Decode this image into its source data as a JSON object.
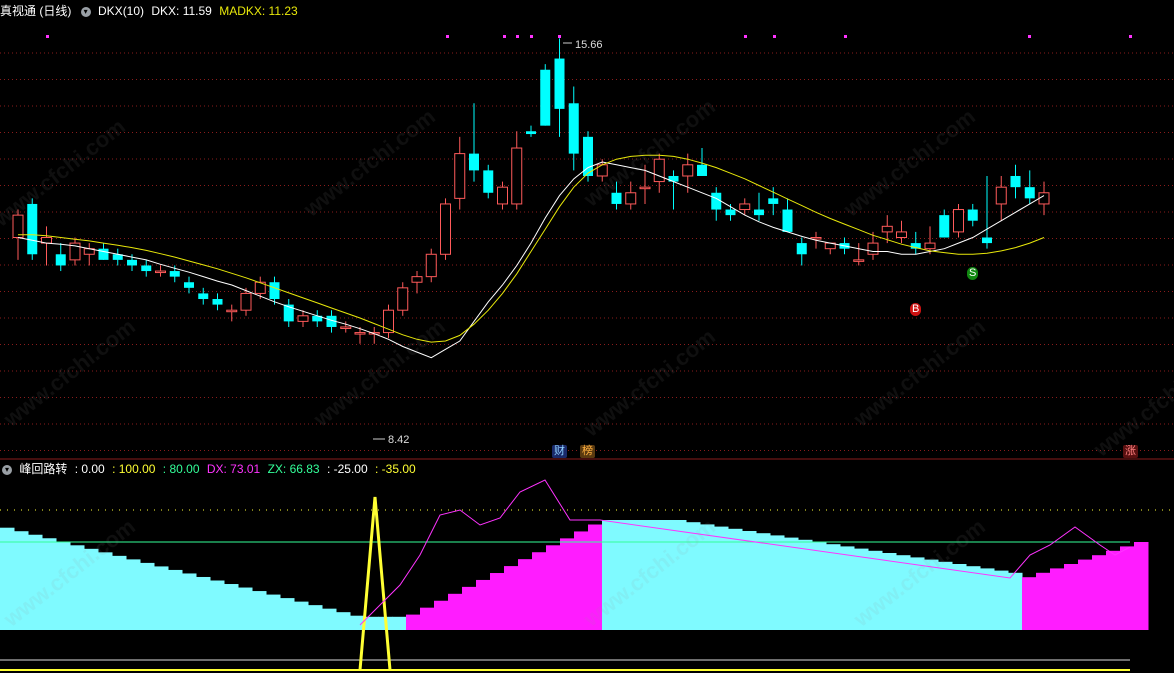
{
  "header": {
    "title": "真视通 (日线)",
    "indicator_label": "DKX(10)",
    "dkx_label": "DKX: 11.59",
    "madkx_label": "MADKX: 11.23"
  },
  "lower_header": {
    "title": "峰回路转",
    "items": [
      ": 0.00",
      ": 100.00",
      ": 80.00",
      "DX: 73.01",
      "ZX: 66.83",
      ": -25.00",
      ": -35.00"
    ]
  },
  "annotations": {
    "high_label": "15.66",
    "low_label": "8.42"
  },
  "markers": {
    "buy": "B",
    "sell": "S",
    "cai": "财",
    "bang": "榜",
    "zhang": "涨"
  },
  "watermark": "www.cfchi.com",
  "colors": {
    "up": "#ff5a5a",
    "down": "#00ffff",
    "dkx": "#ffffff",
    "madkx": "#e8e80a",
    "cyan_fill": "#7ffaff",
    "magenta_fill": "#ff1cff",
    "dx": "#ff33ff",
    "yellow": "#ffff33",
    "green": "#33ff99",
    "grid": "#8a1c1c"
  },
  "chart_data": [
    {
      "type": "candlestick",
      "title": "真视通 (日线)",
      "series": [
        {
          "name": "DKX",
          "values": [
            12.1,
            12.05,
            12.0,
            11.98,
            11.95,
            11.9,
            11.85,
            11.8,
            11.75,
            11.7,
            11.62,
            11.55,
            11.48,
            11.4,
            11.32,
            11.25,
            11.15,
            11.05,
            10.95,
            10.86,
            10.78,
            10.7,
            10.62,
            10.55,
            10.47,
            10.38,
            10.28,
            10.15,
            10.05,
            9.95,
            10.1,
            10.25,
            10.6,
            10.95,
            11.25,
            11.6,
            12.0,
            12.45,
            12.85,
            13.15,
            13.35,
            13.45,
            13.4,
            13.35,
            13.3,
            13.2,
            13.1,
            13.0,
            12.9,
            12.8,
            12.65,
            12.5,
            12.38,
            12.28,
            12.2,
            12.12,
            12.05,
            12.0,
            11.95,
            11.9,
            11.85,
            11.85,
            11.8,
            11.8,
            11.85,
            11.9,
            12.0,
            12.1,
            12.25,
            12.4,
            12.55,
            12.7,
            12.85
          ]
        },
        {
          "name": "MADKX",
          "values": [
            12.15,
            12.15,
            12.13,
            12.1,
            12.07,
            12.04,
            12.0,
            11.96,
            11.92,
            11.87,
            11.81,
            11.75,
            11.68,
            11.61,
            11.54,
            11.46,
            11.38,
            11.29,
            11.2,
            11.11,
            11.02,
            10.93,
            10.84,
            10.75,
            10.66,
            10.56,
            10.46,
            10.36,
            10.28,
            10.23,
            10.25,
            10.35,
            10.55,
            10.8,
            11.1,
            11.45,
            11.85,
            12.25,
            12.65,
            13.0,
            13.25,
            13.4,
            13.5,
            13.55,
            13.57,
            13.57,
            13.55,
            13.5,
            13.43,
            13.35,
            13.25,
            13.15,
            13.03,
            12.91,
            12.79,
            12.67,
            12.55,
            12.44,
            12.34,
            12.24,
            12.14,
            12.06,
            11.98,
            11.92,
            11.86,
            11.83,
            11.8,
            11.8,
            11.82,
            11.86,
            11.92,
            12.0,
            12.1
          ]
        }
      ],
      "ohlc": [
        [
          12.1,
          12.6,
          11.7,
          12.5
        ],
        [
          12.7,
          12.8,
          11.7,
          11.8
        ],
        [
          12.0,
          12.3,
          11.6,
          12.1
        ],
        [
          11.8,
          12.0,
          11.5,
          11.6
        ],
        [
          11.7,
          12.1,
          11.6,
          12.0
        ],
        [
          11.8,
          12.0,
          11.6,
          11.9
        ],
        [
          11.9,
          12.0,
          11.7,
          11.7
        ],
        [
          11.8,
          11.9,
          11.6,
          11.7
        ],
        [
          11.7,
          11.8,
          11.5,
          11.6
        ],
        [
          11.6,
          11.7,
          11.4,
          11.5
        ],
        [
          11.5,
          11.6,
          11.4,
          11.5
        ],
        [
          11.5,
          11.6,
          11.3,
          11.4
        ],
        [
          11.3,
          11.4,
          11.1,
          11.2
        ],
        [
          11.1,
          11.2,
          10.9,
          11.0
        ],
        [
          11.0,
          11.1,
          10.8,
          10.9
        ],
        [
          10.8,
          10.9,
          10.6,
          10.8
        ],
        [
          10.8,
          11.2,
          10.7,
          11.1
        ],
        [
          11.1,
          11.4,
          11.0,
          11.3
        ],
        [
          11.3,
          11.4,
          10.9,
          11.0
        ],
        [
          10.9,
          11.0,
          10.5,
          10.6
        ],
        [
          10.6,
          10.8,
          10.5,
          10.7
        ],
        [
          10.7,
          10.8,
          10.5,
          10.6
        ],
        [
          10.7,
          10.8,
          10.4,
          10.5
        ],
        [
          10.5,
          10.6,
          10.4,
          10.5
        ],
        [
          10.4,
          10.5,
          10.2,
          10.4
        ],
        [
          10.4,
          10.5,
          10.2,
          10.4
        ],
        [
          10.4,
          10.9,
          10.3,
          10.8
        ],
        [
          10.8,
          11.3,
          10.7,
          11.2
        ],
        [
          11.3,
          11.5,
          11.1,
          11.4
        ],
        [
          11.4,
          11.9,
          11.3,
          11.8
        ],
        [
          11.8,
          12.8,
          11.7,
          12.7
        ],
        [
          12.8,
          13.9,
          12.6,
          13.6
        ],
        [
          13.6,
          14.5,
          13.1,
          13.3
        ],
        [
          13.3,
          13.4,
          12.8,
          12.9
        ],
        [
          12.7,
          13.1,
          12.6,
          13.0
        ],
        [
          12.7,
          14.0,
          12.6,
          13.7
        ],
        [
          14.0,
          14.1,
          13.9,
          13.95
        ],
        [
          15.1,
          15.2,
          14.1,
          14.1
        ],
        [
          15.3,
          15.66,
          13.9,
          14.4
        ],
        [
          14.5,
          14.8,
          13.3,
          13.6
        ],
        [
          13.9,
          14.0,
          13.1,
          13.2
        ],
        [
          13.2,
          13.5,
          13.1,
          13.4
        ],
        [
          12.9,
          13.1,
          12.6,
          12.7
        ],
        [
          12.7,
          13.1,
          12.6,
          12.9
        ],
        [
          13.0,
          13.4,
          12.7,
          13.0
        ],
        [
          13.1,
          13.6,
          12.9,
          13.5
        ],
        [
          13.2,
          13.3,
          12.6,
          13.1
        ],
        [
          13.2,
          13.6,
          12.9,
          13.4
        ],
        [
          13.4,
          13.7,
          13.2,
          13.2
        ],
        [
          12.9,
          13.0,
          12.4,
          12.6
        ],
        [
          12.6,
          12.7,
          12.4,
          12.5
        ],
        [
          12.6,
          12.8,
          12.5,
          12.7
        ],
        [
          12.6,
          12.9,
          12.4,
          12.5
        ],
        [
          12.8,
          13.0,
          12.5,
          12.7
        ],
        [
          12.6,
          12.8,
          12.3,
          12.2
        ],
        [
          12.0,
          12.1,
          11.6,
          11.8
        ],
        [
          12.1,
          12.2,
          11.9,
          12.1
        ],
        [
          11.9,
          12.0,
          11.8,
          12.0
        ],
        [
          12.0,
          12.1,
          11.8,
          11.9
        ],
        [
          11.7,
          12.0,
          11.6,
          11.7
        ],
        [
          11.8,
          12.2,
          11.7,
          12.0
        ],
        [
          12.2,
          12.5,
          12.0,
          12.3
        ],
        [
          12.1,
          12.4,
          12.0,
          12.2
        ],
        [
          12.0,
          12.2,
          11.8,
          11.9
        ],
        [
          11.9,
          12.3,
          11.8,
          12.0
        ],
        [
          12.5,
          12.6,
          12.1,
          12.1
        ],
        [
          12.2,
          12.7,
          12.1,
          12.6
        ],
        [
          12.6,
          12.7,
          12.3,
          12.4
        ],
        [
          12.1,
          13.2,
          11.9,
          12.0
        ],
        [
          12.7,
          13.2,
          12.4,
          13.0
        ],
        [
          13.2,
          13.4,
          12.8,
          13.0
        ],
        [
          13.0,
          13.3,
          12.7,
          12.8
        ],
        [
          12.7,
          13.1,
          12.5,
          12.9
        ]
      ],
      "high_label": "15.66",
      "low_label": "8.42"
    },
    {
      "type": "area",
      "title": "峰回路转",
      "levels": {
        "zero": 0,
        "top": 100,
        "high": 80,
        "low1": -25,
        "low2": -35
      },
      "dx_last": 73.01,
      "zx_last": 66.83
    }
  ]
}
